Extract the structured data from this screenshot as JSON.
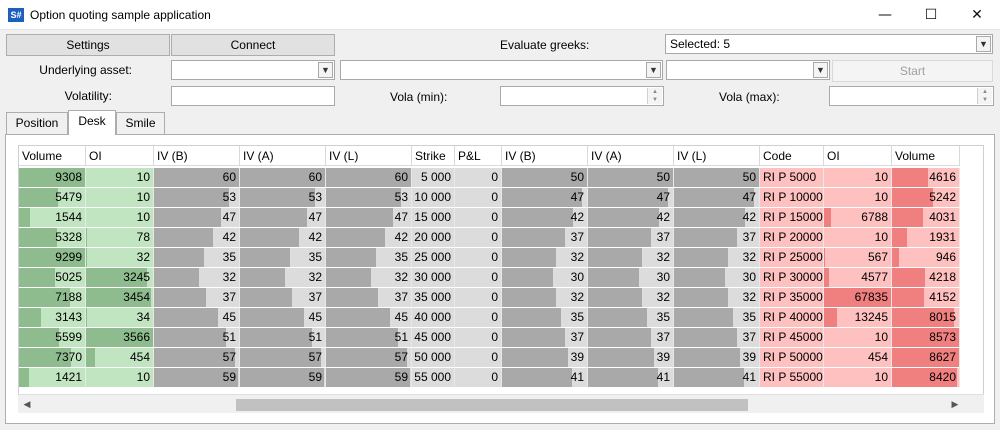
{
  "window": {
    "title": "Option quoting sample application",
    "icon_text": "S#",
    "minimize_glyph": "—",
    "maximize_glyph": "☐",
    "close_glyph": "✕"
  },
  "toolbar": {
    "settings_label": "Settings",
    "connect_label": "Connect",
    "evaluate_greeks_label": "Evaluate greeks:",
    "evaluate_greeks_value": "Selected: 5",
    "underlying_asset_label": "Underlying asset:",
    "start_label": "Start",
    "volatility_label": "Volatility:",
    "vola_min_label": "Vola (min):",
    "vola_max_label": "Vola (max):"
  },
  "tabs": [
    "Position",
    "Desk",
    "Smile"
  ],
  "active_tab": "Desk",
  "colors": {
    "green_strong": "#8fbc8f",
    "green_light": "#c1e4c1",
    "gray_bar": "#a9a9a9",
    "gray_cell": "#dcdcdc",
    "red_light": "#ffc0c0",
    "red_strong": "#f08080"
  },
  "grid": {
    "headers": [
      "Volume",
      "OI",
      "IV (B)",
      "IV (A)",
      "IV (L)",
      "Strike",
      "P&L",
      "IV (B)",
      "IV (A)",
      "IV (L)",
      "Code",
      "OI",
      "Volume"
    ],
    "rows": [
      {
        "c_vol": "9308",
        "c_oi": "10",
        "c_ivb": "60",
        "c_iva": "60",
        "c_ivl": "60",
        "strike": "5 000",
        "pnl": "0",
        "p_ivb": "50",
        "p_iva": "50",
        "p_ivl": "50",
        "code": "RI P 5000",
        "p_oi": "10",
        "p_vol": "4616"
      },
      {
        "c_vol": "5479",
        "c_oi": "10",
        "c_ivb": "53",
        "c_iva": "53",
        "c_ivl": "53",
        "strike": "10 000",
        "pnl": "0",
        "p_ivb": "47",
        "p_iva": "47",
        "p_ivl": "47",
        "code": "RI P 10000",
        "p_oi": "10",
        "p_vol": "5242"
      },
      {
        "c_vol": "1544",
        "c_oi": "10",
        "c_ivb": "47",
        "c_iva": "47",
        "c_ivl": "47",
        "strike": "15 000",
        "pnl": "0",
        "p_ivb": "42",
        "p_iva": "42",
        "p_ivl": "42",
        "code": "RI P 15000",
        "p_oi": "6788",
        "p_vol": "4031"
      },
      {
        "c_vol": "5328",
        "c_oi": "78",
        "c_ivb": "42",
        "c_iva": "42",
        "c_ivl": "42",
        "strike": "20 000",
        "pnl": "0",
        "p_ivb": "37",
        "p_iva": "37",
        "p_ivl": "37",
        "code": "RI P 20000",
        "p_oi": "10",
        "p_vol": "1931"
      },
      {
        "c_vol": "9299",
        "c_oi": "32",
        "c_ivb": "35",
        "c_iva": "35",
        "c_ivl": "35",
        "strike": "25 000",
        "pnl": "0",
        "p_ivb": "32",
        "p_iva": "32",
        "p_ivl": "32",
        "code": "RI P 25000",
        "p_oi": "567",
        "p_vol": "946"
      },
      {
        "c_vol": "5025",
        "c_oi": "3245",
        "c_ivb": "32",
        "c_iva": "32",
        "c_ivl": "32",
        "strike": "30 000",
        "pnl": "0",
        "p_ivb": "30",
        "p_iva": "30",
        "p_ivl": "30",
        "code": "RI P 30000",
        "p_oi": "4577",
        "p_vol": "4218"
      },
      {
        "c_vol": "7188",
        "c_oi": "3454",
        "c_ivb": "37",
        "c_iva": "37",
        "c_ivl": "37",
        "strike": "35 000",
        "pnl": "0",
        "p_ivb": "32",
        "p_iva": "32",
        "p_ivl": "32",
        "code": "RI P 35000",
        "p_oi": "67835",
        "p_vol": "4152"
      },
      {
        "c_vol": "3143",
        "c_oi": "34",
        "c_ivb": "45",
        "c_iva": "45",
        "c_ivl": "45",
        "strike": "40 000",
        "pnl": "0",
        "p_ivb": "35",
        "p_iva": "35",
        "p_ivl": "35",
        "code": "RI P 40000",
        "p_oi": "13245",
        "p_vol": "8015"
      },
      {
        "c_vol": "5599",
        "c_oi": "3566",
        "c_ivb": "51",
        "c_iva": "51",
        "c_ivl": "51",
        "strike": "45 000",
        "pnl": "0",
        "p_ivb": "37",
        "p_iva": "37",
        "p_ivl": "37",
        "code": "RI P 45000",
        "p_oi": "10",
        "p_vol": "8573"
      },
      {
        "c_vol": "7370",
        "c_oi": "454",
        "c_ivb": "57",
        "c_iva": "57",
        "c_ivl": "57",
        "strike": "50 000",
        "pnl": "0",
        "p_ivb": "39",
        "p_iva": "39",
        "p_ivl": "39",
        "code": "RI P 50000",
        "p_oi": "454",
        "p_vol": "8627"
      },
      {
        "c_vol": "1421",
        "c_oi": "10",
        "c_ivb": "59",
        "c_iva": "59",
        "c_ivl": "59",
        "strike": "55 000",
        "pnl": "0",
        "p_ivb": "41",
        "p_iva": "41",
        "p_ivl": "41",
        "code": "RI P 55000",
        "p_oi": "10",
        "p_vol": "8420"
      }
    ]
  }
}
